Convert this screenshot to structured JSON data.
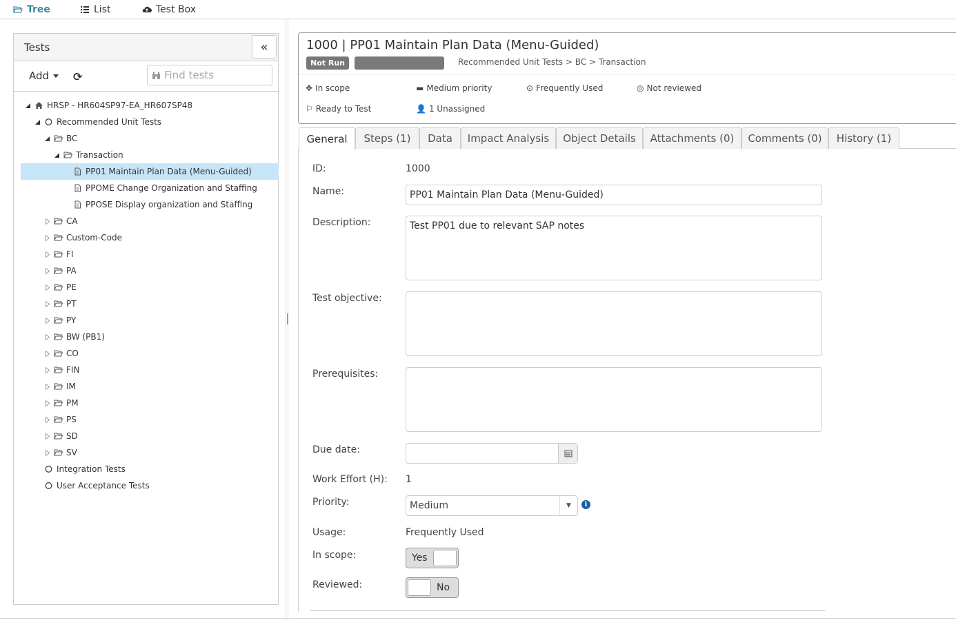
{
  "topnav": {
    "tree": "Tree",
    "list": "List",
    "testbox": "Test Box"
  },
  "left": {
    "title": "Tests",
    "add_label": "Add",
    "search_placeholder": "Find tests",
    "tree": [
      "HRSP - HR604SP97-EA_HR607SP48",
      "Recommended Unit Tests",
      "BC",
      "Transaction",
      "PP01 Maintain Plan Data (Menu-Guided)",
      "PPOME Change Organization and Staffing",
      "PPOSE Display organization and Staffing",
      "CA",
      "Custom-Code",
      "FI",
      "PA",
      "PE",
      "PT",
      "PY",
      "BW (PB1)",
      "CO",
      "FIN",
      "IM",
      "PM",
      "PS",
      "SD",
      "SV",
      "Integration Tests",
      "User Acceptance Tests"
    ]
  },
  "header": {
    "title": "1000 | PP01 Maintain Plan Data (Menu-Guided)",
    "status_badge": "Not Run",
    "breadcrumb": "Recommended Unit Tests > BC > Transaction",
    "scope": "In scope",
    "priority": "Medium priority",
    "usage": "Frequently Used",
    "review": "Not reviewed",
    "state": "Ready to Test",
    "assignee": "1 Unassigned"
  },
  "tabs": [
    "General",
    "Steps (1)",
    "Data",
    "Impact Analysis",
    "Object Details",
    "Attachments (0)",
    "Comments (0)",
    "History (1)"
  ],
  "form": {
    "id_label": "ID:",
    "id_value": "1000",
    "name_label": "Name:",
    "name_value": "PP01 Maintain Plan Data (Menu-Guided)",
    "description_label": "Description:",
    "description_value": "Test PP01 due to relevant SAP notes",
    "objective_label": "Test objective:",
    "objective_value": "",
    "prereq_label": "Prerequisites:",
    "prereq_value": "",
    "due_label": "Due date:",
    "due_value": "",
    "effort_label": "Work Effort (H):",
    "effort_value": "1",
    "priority_label": "Priority:",
    "priority_value": "Medium",
    "usage_label": "Usage:",
    "usage_value": "Frequently Used",
    "inscope_label": "In scope:",
    "inscope_value": "Yes",
    "reviewed_label": "Reviewed:",
    "reviewed_value": "No"
  },
  "colors": {
    "accent": "#3a87ad",
    "selection": "#c6e5f8",
    "badge": "#777777"
  }
}
